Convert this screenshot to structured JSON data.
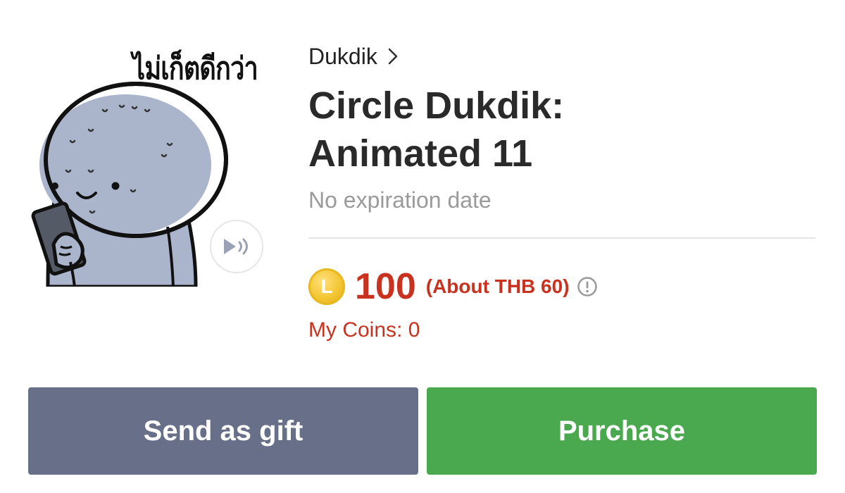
{
  "sticker": {
    "caption_th": "ไม่เก็ตดีกว่า",
    "play_icon": "play-sound-icon"
  },
  "product": {
    "author": "Dukdik",
    "author_chevron": ">",
    "title": "Circle Dukdik: Animated 11",
    "expiry": "No expiration date"
  },
  "pricing": {
    "coin_letter": "L",
    "price": "100",
    "approx": "(About THB 60)",
    "my_coins": "My Coins: 0"
  },
  "actions": {
    "gift_label": "Send as gift",
    "purchase_label": "Purchase"
  },
  "colors": {
    "price_red": "#c8321f",
    "gift_button": "#676f89",
    "purchase_button": "#4aa84e",
    "coin_gold": "#f3c531"
  }
}
